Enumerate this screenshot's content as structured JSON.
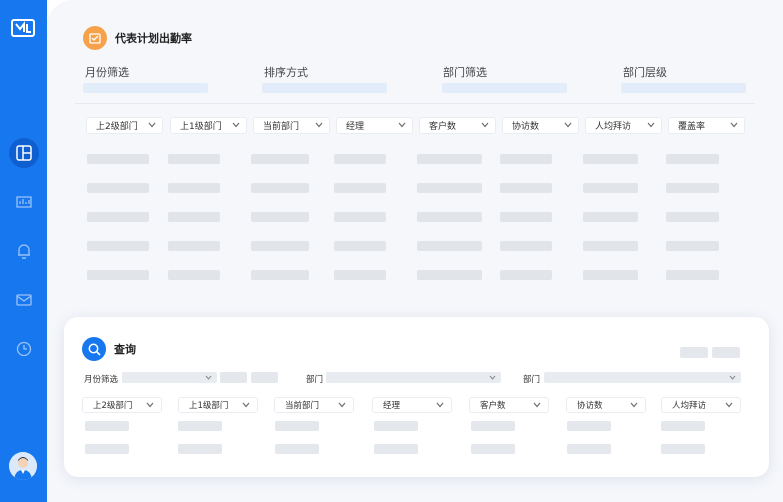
{
  "section": {
    "title": "代表计划出勤率"
  },
  "filters": [
    {
      "label": "月份筛选"
    },
    {
      "label": "排序方式"
    },
    {
      "label": "部门筛选"
    },
    {
      "label": "部门层级"
    }
  ],
  "columns": [
    "上2级部门",
    "上1级部门",
    "当前部门",
    "经理",
    "客户数",
    "协访数",
    "人均拜访",
    "覆盖率"
  ],
  "query": {
    "title": "查询",
    "month_label": "月份筛选",
    "dept_label_1": "部门",
    "dept_label_2": "部门",
    "columns": [
      "上2级部门",
      "上1级部门",
      "当前部门",
      "经理",
      "客户数",
      "协访数",
      "人均拜访"
    ]
  },
  "colors": {
    "sidebar": "#1677ee",
    "accent_orange": "#f6a24b",
    "background": "#f5f7fb"
  },
  "icons": [
    "logo-icon",
    "dashboard-icon",
    "report-icon",
    "bell-icon",
    "mail-icon",
    "clock-icon",
    "avatar-icon",
    "calendar-icon",
    "search-icon"
  ]
}
